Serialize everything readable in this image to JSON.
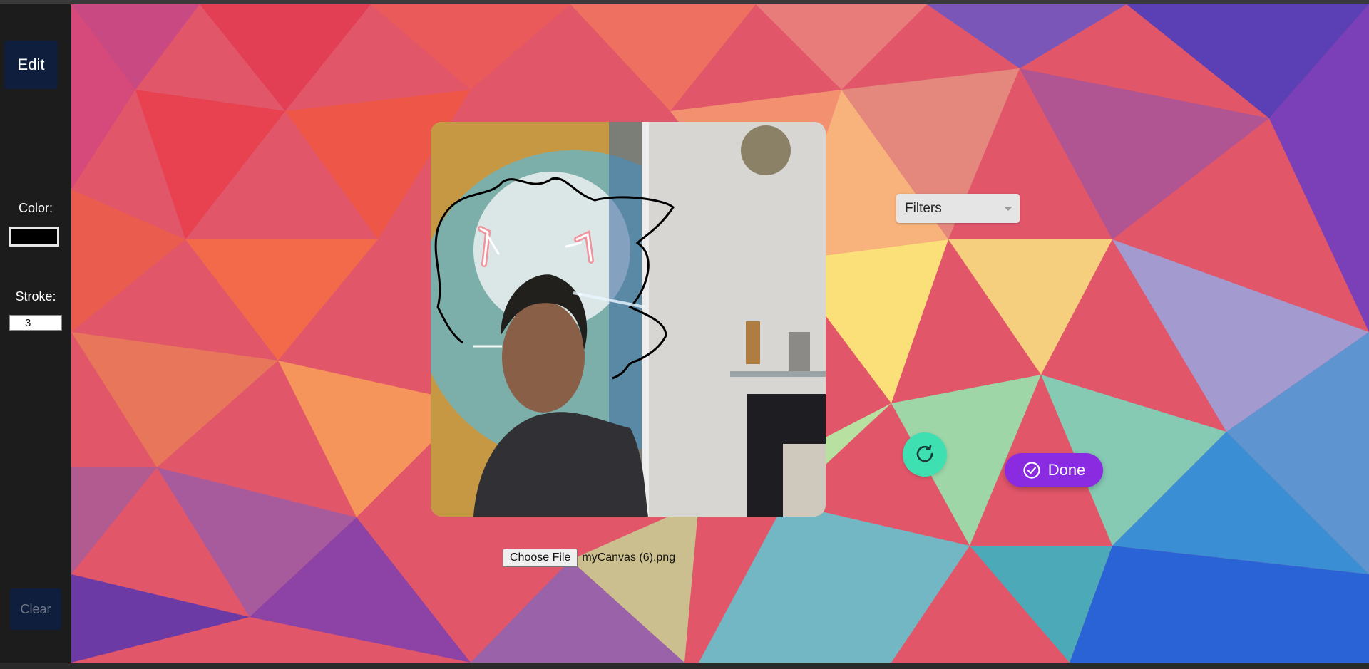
{
  "sidebar": {
    "edit_label": "Edit",
    "color_label": "Color:",
    "color_value": "#000000",
    "stroke_label": "Stroke:",
    "stroke_value": "3",
    "clear_label": "Clear"
  },
  "file_input": {
    "button_label": "Choose File",
    "file_name": "myCanvas (6).png"
  },
  "filters": {
    "selected_label": "Filters"
  },
  "actions": {
    "done_label": "Done",
    "refresh_icon": "refresh-icon",
    "done_icon": "check-circle-icon"
  },
  "colors": {
    "sidebar_bg": "#1c1c1c",
    "button_navy": "#0f1e3d",
    "refresh_teal": "#3ee0b1",
    "done_purple": "#8a2be2"
  }
}
